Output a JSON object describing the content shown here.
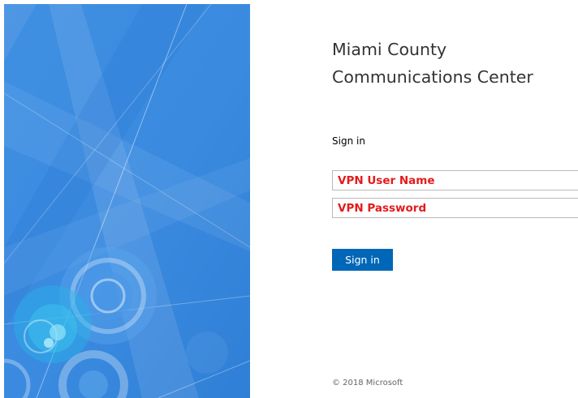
{
  "organization": {
    "title": "Miami County Communications Center"
  },
  "form": {
    "heading": "Sign in",
    "username_field": {
      "placeholder": "VPN User Name",
      "value": ""
    },
    "password_field": {
      "placeholder": "VPN Password",
      "value": ""
    },
    "submit_label": "Sign in"
  },
  "footer": {
    "copyright": "© 2018 Microsoft"
  },
  "colors": {
    "illustration_background": "#3e8ee0",
    "button_background": "#0067b8",
    "placeholder_text": "#e41b1b"
  }
}
